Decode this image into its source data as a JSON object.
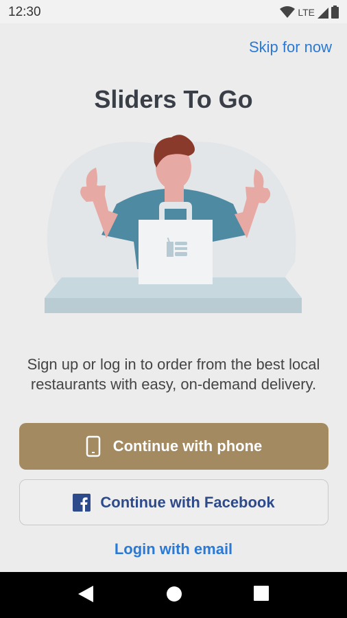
{
  "status_bar": {
    "time": "12:30",
    "network": "LTE",
    "icons": [
      "wifi-icon",
      "signal-icon",
      "battery-icon"
    ]
  },
  "header": {
    "skip_label": "Skip for now",
    "title": "Sliders To Go"
  },
  "illustration": {
    "description_icon": "person-with-takeout-bag-illustration"
  },
  "tagline": "Sign up or log in to order from the best local restaurants with easy, on-demand delivery.",
  "buttons": {
    "phone_label": "Continue with phone",
    "phone_icon": "phone-icon",
    "facebook_label": "Continue with Facebook",
    "facebook_icon": "facebook-icon",
    "email_label": "Login with email"
  },
  "nav": {
    "icons": [
      "back-icon",
      "home-icon",
      "recents-icon"
    ]
  },
  "colors": {
    "accent_link": "#2a79d4",
    "primary_button": "#a38a60",
    "facebook_text": "#2d4a8a",
    "background": "#ececec"
  }
}
